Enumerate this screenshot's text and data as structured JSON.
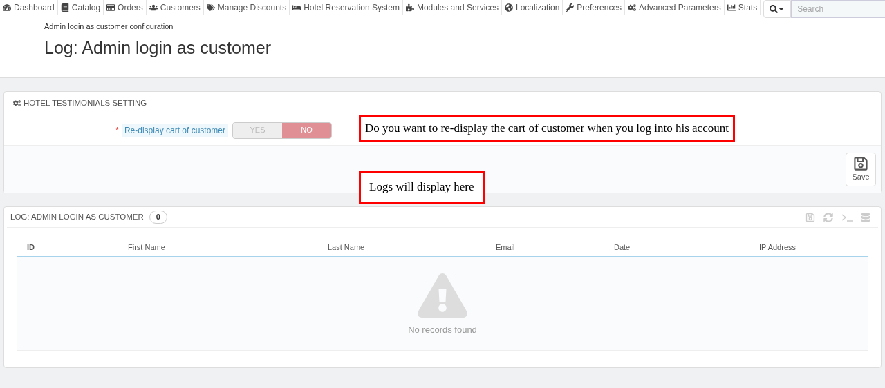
{
  "nav": {
    "items": [
      {
        "label": "Dashboard"
      },
      {
        "label": "Catalog"
      },
      {
        "label": "Orders"
      },
      {
        "label": "Customers"
      },
      {
        "label": "Manage Discounts"
      },
      {
        "label": "Hotel Reservation System"
      },
      {
        "label": "Modules and Services"
      },
      {
        "label": "Localization"
      },
      {
        "label": "Preferences"
      },
      {
        "label": "Advanced Parameters"
      },
      {
        "label": "Stats"
      }
    ],
    "search": {
      "placeholder": "Search"
    }
  },
  "header": {
    "breadcrumb": "Admin login as customer configuration",
    "title": "Log: Admin login as customer"
  },
  "settings_panel": {
    "title": "HOTEL TESTIMONIALS SETTING",
    "field": {
      "label": "Re-display cart of customer",
      "required_mark": "*",
      "options": [
        {
          "label": "YES",
          "selected": false
        },
        {
          "label": "NO",
          "selected": true
        }
      ]
    },
    "save_button": "Save"
  },
  "annotations": [
    {
      "text": "Do you want to re-display the cart of customer when you log into his account"
    },
    {
      "text": "Logs will display here"
    }
  ],
  "log_panel": {
    "title": "LOG: ADMIN LOGIN AS CUSTOMER",
    "count": "0",
    "columns": [
      "ID",
      "First Name",
      "Last Name",
      "Email",
      "Date",
      "IP Address"
    ],
    "empty_message": "No records found"
  }
}
